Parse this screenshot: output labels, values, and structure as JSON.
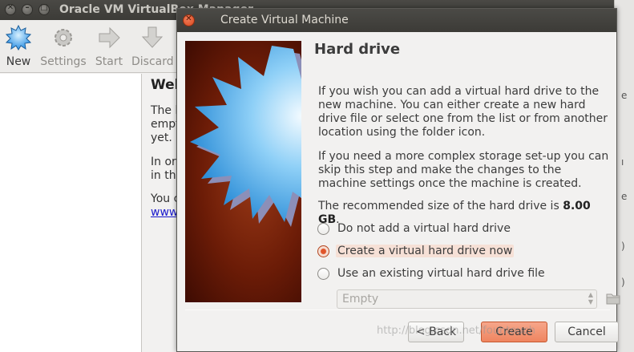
{
  "main_window": {
    "title": "Oracle VM VirtualBox Manager",
    "toolbar": [
      {
        "label": "New",
        "icon": "new-icon",
        "active": true
      },
      {
        "label": "Settings",
        "icon": "settings-gear-icon",
        "active": false
      },
      {
        "label": "Start",
        "icon": "start-arrow-icon",
        "active": false
      },
      {
        "label": "Discard",
        "icon": "discard-arrow-icon",
        "active": false
      }
    ],
    "welcome": {
      "heading": "Welc",
      "lines": [
        "The l",
        "empt",
        "yet.",
        "In ord",
        "in the",
        "You c"
      ],
      "link": "www"
    }
  },
  "dialog": {
    "title": "Create Virtual Machine",
    "page_title": "Hard drive",
    "para1": "If you wish you can add a virtual hard drive to the new machine. You can either create a new hard drive file or select one from the list or from another location using the folder icon.",
    "para2": "If you need a more complex storage set-up you can skip this step and make the changes to the machine settings once the machine is created.",
    "recommended_prefix": "The recommended size of the hard drive is ",
    "recommended_size": "8.00 GB",
    "recommended_suffix": ".",
    "options": [
      {
        "label": "Do not add a virtual hard drive",
        "checked": false
      },
      {
        "label": "Create a virtual hard drive now",
        "checked": true
      },
      {
        "label": "Use an existing virtual hard drive file",
        "checked": false
      }
    ],
    "existing_file_combo": {
      "value": "Empty",
      "enabled": false
    },
    "buttons": {
      "back": "< Back",
      "create": "Create",
      "cancel": "Cancel"
    }
  },
  "watermark": "http://blog.csdn.net/fountouch",
  "colors": {
    "accent": "#ef8560",
    "titlebar": "#3c3b37",
    "banner": "#6c1c07",
    "link": "#1a1acd"
  }
}
